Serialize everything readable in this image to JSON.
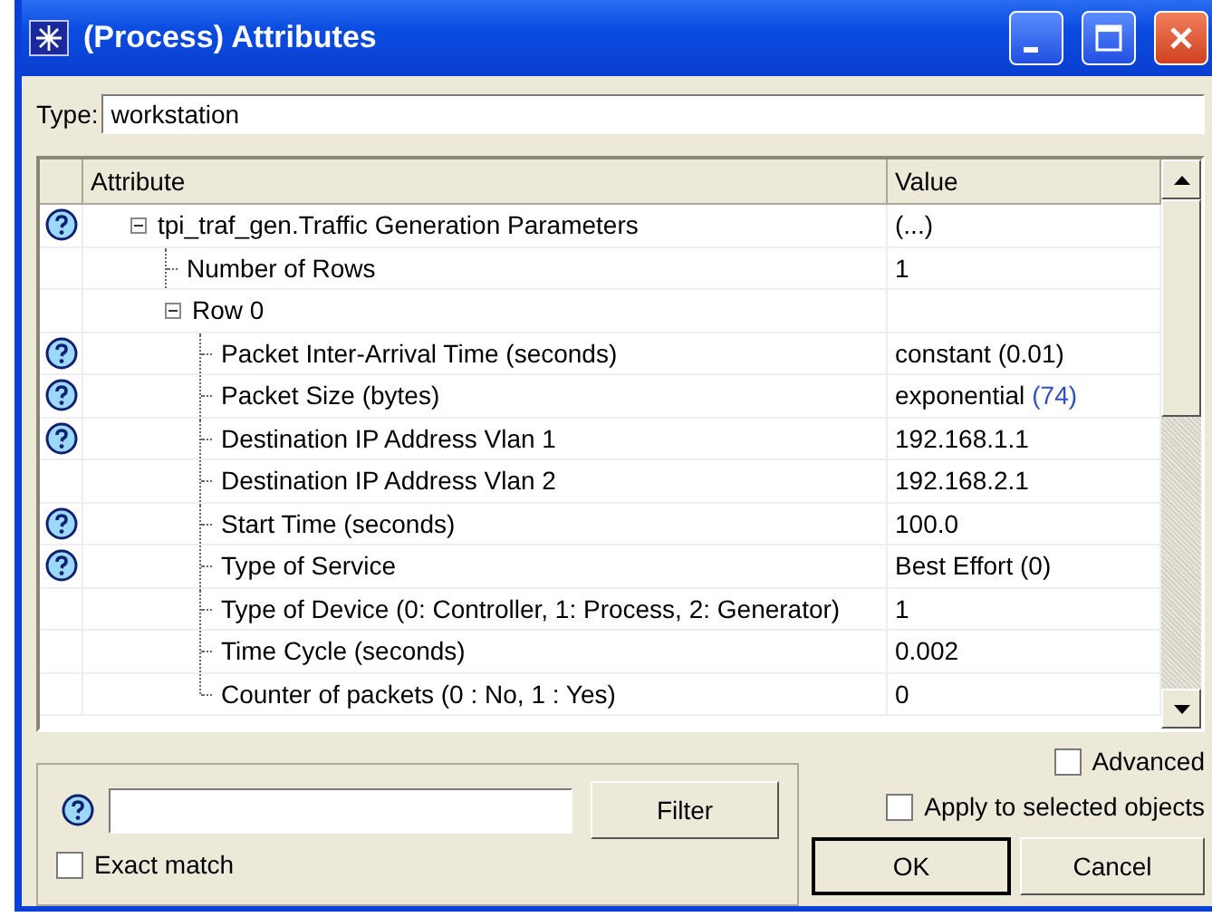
{
  "window": {
    "title": "(Process) Attributes"
  },
  "type_field": {
    "label": "Type:",
    "value": "workstation"
  },
  "table": {
    "columns": [
      "Attribute",
      "Value"
    ],
    "rows": [
      {
        "label": "tpi_traf_gen.Traffic Generation Parameters",
        "value": "(...)",
        "help": true,
        "expanded": true,
        "children": [
          {
            "label": "Number of Rows",
            "value": "1",
            "help": false
          },
          {
            "label": "Row 0",
            "help": false,
            "expanded": true,
            "children": [
              {
                "label": "Packet Inter-Arrival Time (seconds)",
                "value": "constant (0.01)",
                "help": true
              },
              {
                "label": "Packet Size (bytes)",
                "value": "exponential",
                "value_note": "(74)",
                "help": true
              },
              {
                "label": "Destination IP Address Vlan 1",
                "value": "192.168.1.1",
                "help": true
              },
              {
                "label": "Destination IP Address Vlan 2",
                "value": "192.168.2.1",
                "help": false
              },
              {
                "label": "Start Time (seconds)",
                "value": "100.0",
                "help": true
              },
              {
                "label": "Type of Service",
                "value": "Best Effort (0)",
                "help": true
              },
              {
                "label": "Type of Device (0: Controller, 1: Process, 2: Generator)",
                "value": "1",
                "help": false
              },
              {
                "label": "Time Cycle (seconds)",
                "value": "0.002",
                "help": false
              },
              {
                "label": "Counter of packets (0 : No, 1 : Yes)",
                "value": "0",
                "help": false
              }
            ]
          }
        ]
      }
    ]
  },
  "filter": {
    "button": "Filter",
    "exact_match": {
      "label": "Exact match",
      "checked": false
    }
  },
  "options": [
    {
      "label": "Advanced",
      "checked": false
    },
    {
      "label": "Apply to selected objects",
      "checked": false
    }
  ],
  "buttons": [
    "OK",
    "Cancel"
  ]
}
